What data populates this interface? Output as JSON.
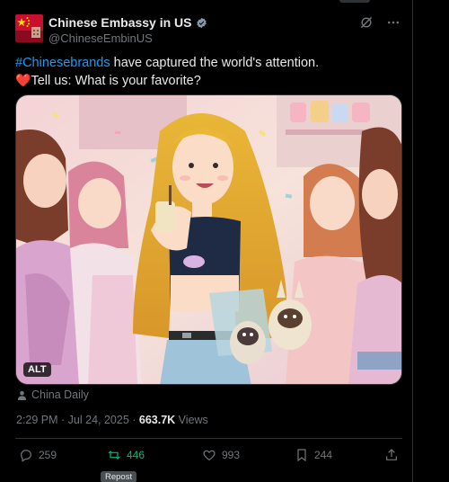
{
  "author": {
    "display_name": "Chinese Embassy in US",
    "handle": "@ChineseEmbinUS",
    "verified_color": "#829aab"
  },
  "header_icons": [
    "grok-icon",
    "more-icon"
  ],
  "tweet": {
    "hashtag": "#Chinesebrands",
    "line1_rest": " have captured the world's attention.",
    "line2": "Tell us: What is your favorite?",
    "emoji": "❤️"
  },
  "media": {
    "alt_label": "ALT"
  },
  "source": {
    "label": "China Daily"
  },
  "meta": {
    "time": "2:29 PM",
    "separator": " · ",
    "date": "Jul 24, 2025",
    "views_count": "663.7K",
    "views_label": " Views"
  },
  "actions": {
    "reply_count": "259",
    "repost_count": "446",
    "like_count": "993",
    "bookmark_count": "244"
  },
  "tooltip": {
    "label": "Repost"
  },
  "colors": {
    "background": "#000000",
    "link": "#1d9bf0",
    "muted": "#71767b",
    "repost_active": "#00ba7c",
    "heart": "#f91880"
  }
}
